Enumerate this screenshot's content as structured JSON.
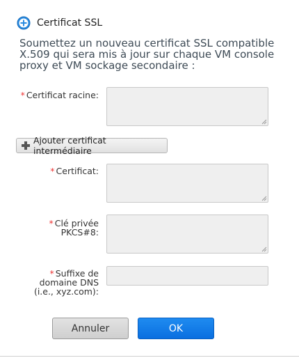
{
  "dialog": {
    "title": "Certificat SSL",
    "description": "Soumettez un nouveau certificat SSL compatible X.509 qui sera mis à jour sur chaque VM console proxy et VM sockage secondaire :"
  },
  "fields": {
    "root_certificate": {
      "label": "Certificat racine:",
      "value": "",
      "required": true
    },
    "add_intermediate_label": "Ajouter certificat intermédiaire",
    "certificate": {
      "label": "Certificat:",
      "value": "",
      "required": true
    },
    "private_key": {
      "label_line1": "Clé privée",
      "label_line2": "PKCS#8:",
      "value": "",
      "required": true
    },
    "dns_suffix": {
      "label_line1": "Suffixe de",
      "label_line2": "domaine DNS",
      "label_line3": "(i.e., xyz.com):",
      "value": "",
      "required": true
    }
  },
  "buttons": {
    "cancel": "Annuler",
    "ok": "OK"
  },
  "required_marker": "*",
  "colors": {
    "accent": "#0a6fe0",
    "required": "#ee3333",
    "field_bg": "#efefef"
  }
}
